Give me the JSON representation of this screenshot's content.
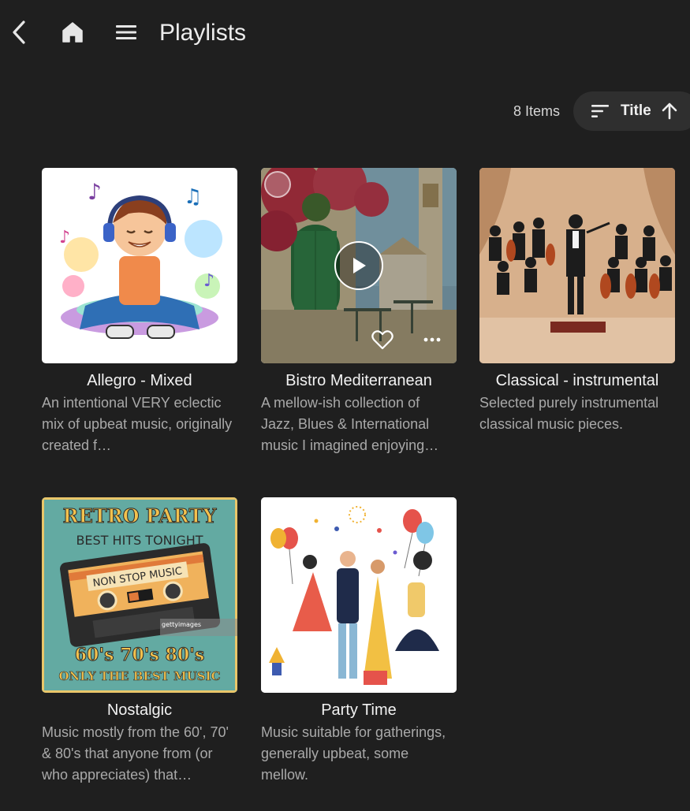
{
  "header": {
    "title": "Playlists",
    "back_icon": "chevron-left-icon",
    "home_icon": "home-icon",
    "menu_icon": "hamburger-menu-icon"
  },
  "toolbar": {
    "item_count": "8 Items",
    "sort_label": "Title",
    "sort_icon": "sort-lines-icon",
    "sort_direction_icon": "arrow-up-icon"
  },
  "playlists": [
    {
      "name": "Allegro - Mixed",
      "description": "An intentional VERY eclectic mix of upbeat music, originally created f…"
    },
    {
      "name": "Bistro Mediterranean",
      "description": "A mellow-ish collection of Jazz, Blues & International music I imagined enjoying…",
      "hover_controls": [
        "select-circle-icon",
        "play-icon",
        "heart-icon",
        "more-dots-icon"
      ]
    },
    {
      "name": "Classical - instrumental",
      "description": "Selected purely instrumental classical music pieces."
    },
    {
      "name": "Nostalgic",
      "description": "Music mostly from the 60', 70' & 80's that anyone from (or who appreciates) that…",
      "artwork_text": {
        "line1": "RETRO PARTY",
        "line2": "BEST HITS TONIGHT",
        "tape": "NON STOP MUSIC",
        "line3": "60's 70's 80's",
        "line4": "ONLY THE BEST MUSIC",
        "watermark": "gettyimages"
      }
    },
    {
      "name": "Party Time",
      "description": "Music suitable for gatherings, generally upbeat, some mellow."
    }
  ],
  "colors": {
    "background": "#1f1f1f",
    "sort_pill": "#2f2f2f",
    "description_text": "#a9a9a9"
  }
}
